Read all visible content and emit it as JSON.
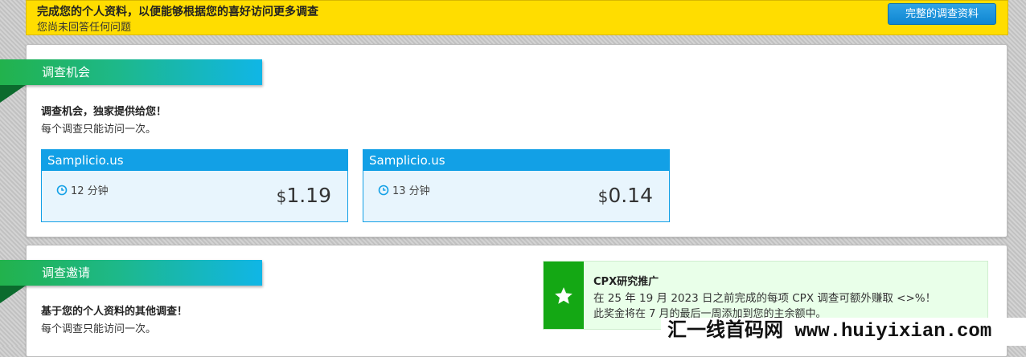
{
  "notice": {
    "title": "完成您的个人资料，以便能够根据您的喜好访问更多调查",
    "subtitle": "您尚未回答任何问题",
    "button_label": "完整的调查资料"
  },
  "opportunities": {
    "ribbon_label": "调查机会",
    "heading": "调查机会，独家提供给您！",
    "subheading": "每个调查只能访问一次。",
    "cards": [
      {
        "provider": "Samplicio.us",
        "duration": "12 分钟",
        "currency": "$",
        "amount": "1.19",
        "icon": "clock-icon"
      },
      {
        "provider": "Samplicio.us",
        "duration": "13 分钟",
        "currency": "$",
        "amount": "0.14",
        "icon": "clock-icon"
      }
    ]
  },
  "invitations": {
    "ribbon_label": "调查邀请",
    "heading": "基于您的个人资料的其他调查！",
    "subheading": "每个调查只能访问一次。"
  },
  "promo": {
    "icon": "star-icon",
    "title": "CPX研究推广",
    "line1": "在 25 年 19 月 2023 日之前完成的每项 CPX 调查可额外赚取 <>%！",
    "line2": "此奖金将在 7 月的最后一周添加到您的主余额中。"
  },
  "watermark": {
    "text": "汇一线首码网 www.huiyixian.com"
  },
  "colors": {
    "notice_bg": "#ffdd00",
    "button_blue": "#0f86d1",
    "card_blue": "#12a0e6",
    "promo_green": "#14a814",
    "ribbon_green": "#22b24c"
  }
}
